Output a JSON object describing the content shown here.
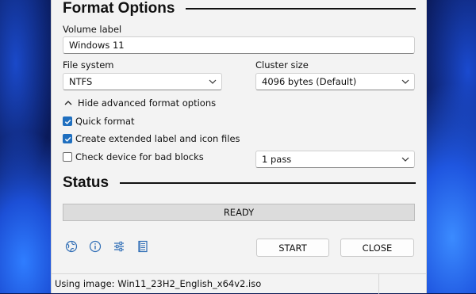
{
  "format_options": {
    "title": "Format Options",
    "volume_label": {
      "label": "Volume label",
      "value": "Windows 11"
    },
    "file_system": {
      "label": "File system",
      "value": "NTFS"
    },
    "cluster_size": {
      "label": "Cluster size",
      "value": "4096 bytes (Default)"
    },
    "advanced_toggle": "Hide advanced format options",
    "quick_format": {
      "label": "Quick format",
      "checked": true
    },
    "extended_label": {
      "label": "Create extended label and icon files",
      "checked": true
    },
    "bad_blocks": {
      "label": "Check device for bad blocks",
      "checked": false,
      "passes": "1 pass"
    }
  },
  "status": {
    "title": "Status",
    "state": "READY"
  },
  "buttons": {
    "start": "START",
    "close": "CLOSE"
  },
  "icons": [
    "globe-icon",
    "info-icon",
    "settings-sliders-icon",
    "log-icon"
  ],
  "footer": {
    "message": "Using image: Win11_23H2_English_x64v2.iso"
  },
  "colors": {
    "accent": "#1f6fbf",
    "window_bg": "#f3f3f3"
  }
}
